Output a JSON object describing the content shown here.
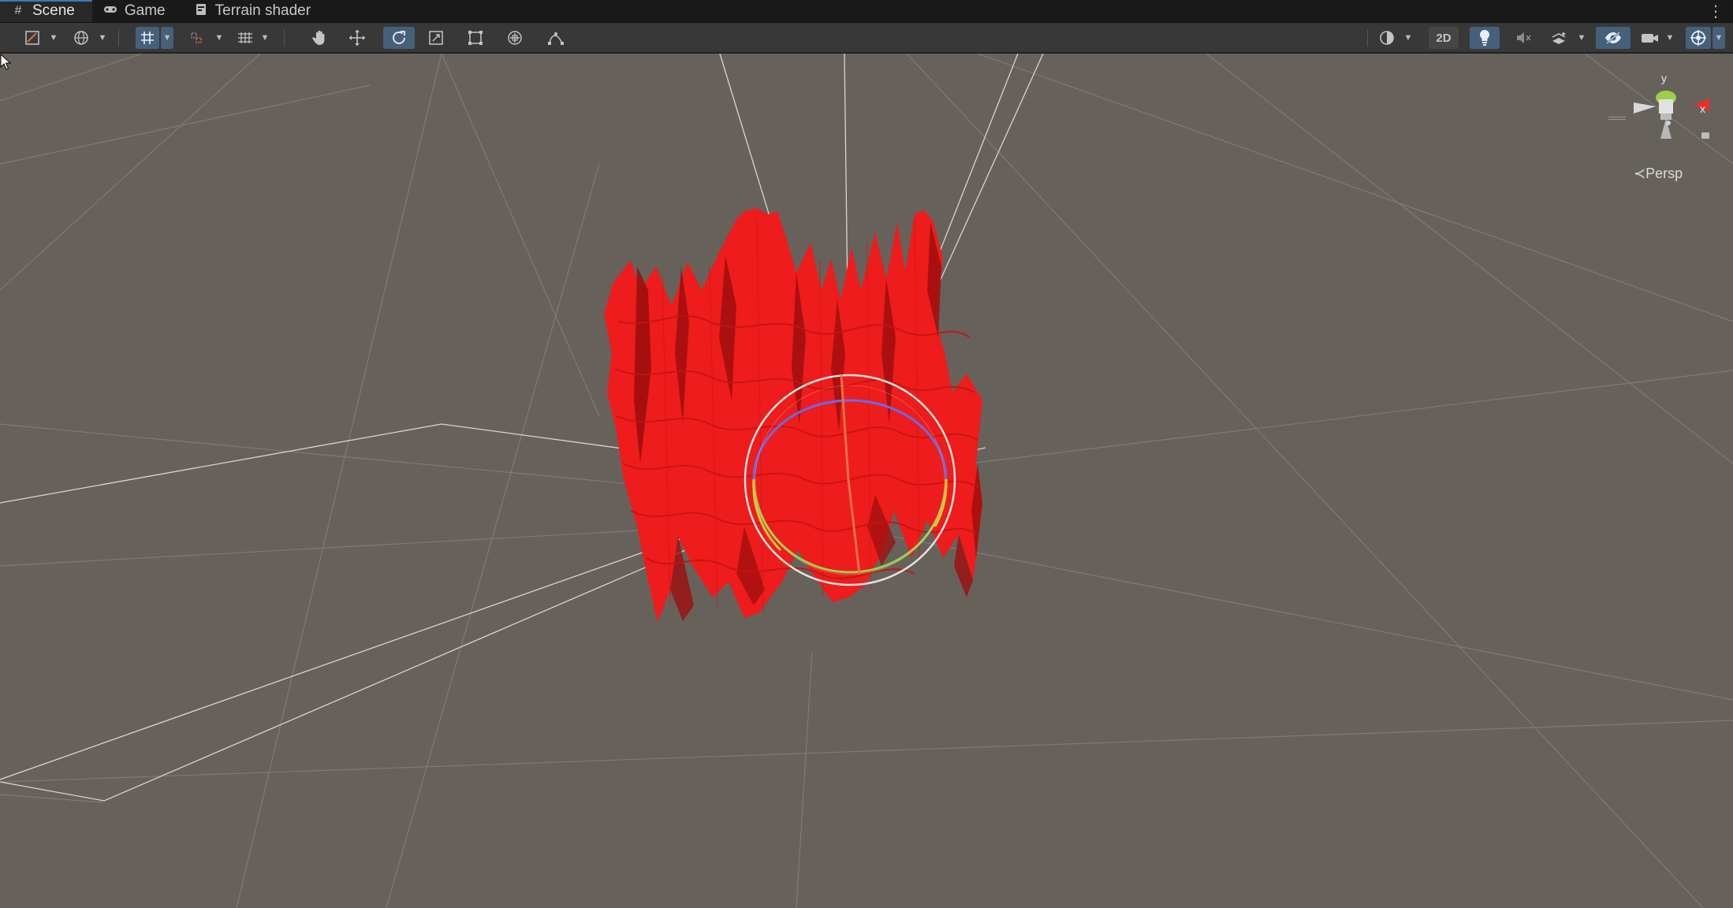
{
  "tabs": [
    {
      "label": "Scene",
      "icon": "hash-icon",
      "active": true
    },
    {
      "label": "Game",
      "icon": "gamepad-icon",
      "active": false
    },
    {
      "label": "Terrain shader",
      "icon": "shader-graph-icon",
      "active": false
    }
  ],
  "toolbar": {
    "left_tools": [
      "draw-mode",
      "global-local",
      "grid-snap",
      "increment-snap",
      "grid-visibility"
    ],
    "transform_tools": [
      "hand-tool",
      "move-tool",
      "rotate-tool",
      "scale-tool",
      "rect-tool",
      "transform-tool",
      "custom-tool"
    ],
    "active_tool": "rotate-tool",
    "mode_2d_label": "2D",
    "lighting_on": true,
    "audio_on": false,
    "effects_enabled": true,
    "hidden_objects_visible": true,
    "gizmos_enabled": true
  },
  "scene": {
    "projection_label": "Persp",
    "orientation_gizmo": {
      "y_label": "y",
      "x_label": "x"
    },
    "colors": {
      "background": "#67615b",
      "terrain": "#ee1c1c",
      "terrain_shade": "#9e0e0e",
      "gizmo_x": "#e8302a",
      "gizmo_y": "#9bd04a",
      "gizmo_z": "#4a6fe0"
    }
  }
}
